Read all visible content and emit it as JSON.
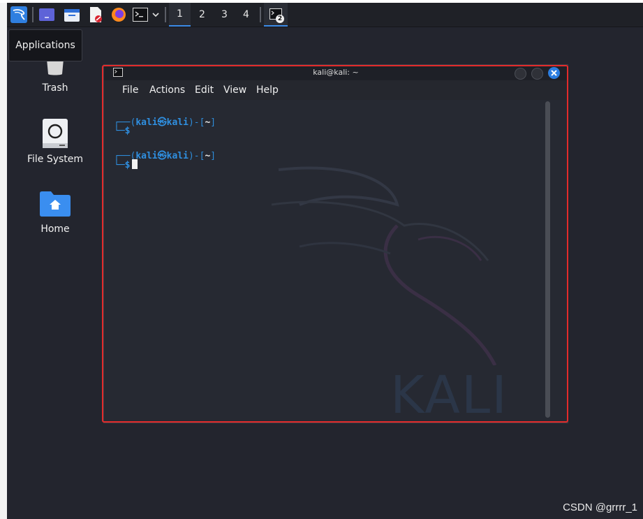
{
  "taskbar": {
    "workspaces": [
      {
        "label": "1",
        "active": true
      },
      {
        "label": "2",
        "active": false
      },
      {
        "label": "3",
        "active": false
      },
      {
        "label": "4",
        "active": false
      }
    ],
    "task_badge": "2",
    "tooltip": "Applications"
  },
  "desktop": {
    "icons": [
      {
        "label": "Trash"
      },
      {
        "label": "File System"
      },
      {
        "label": "Home"
      }
    ]
  },
  "terminal": {
    "title": "kali@kali: ~",
    "menu": [
      "File",
      "Actions",
      "Edit",
      "View",
      "Help"
    ],
    "prompts": [
      {
        "frame_start": "┌──(",
        "user": "kali",
        "at": "㉿",
        "host": "kali",
        "mid": ")-[",
        "path": "~",
        "end": "]",
        "second_line": "└─$"
      },
      {
        "frame_start": "┌──(",
        "user": "kali",
        "at": "㉿",
        "host": "kali",
        "mid": ")-[",
        "path": "~",
        "end": "]",
        "second_line": "└─$"
      }
    ],
    "watermark_text": "KALI"
  },
  "footer": {
    "watermark": "CSDN @grrrr_1"
  },
  "colors": {
    "accent": "#3b8be8",
    "highlight": "#e32b2b",
    "close_button": "#2b7de0",
    "prompt_blue": "#2f8fe0"
  }
}
